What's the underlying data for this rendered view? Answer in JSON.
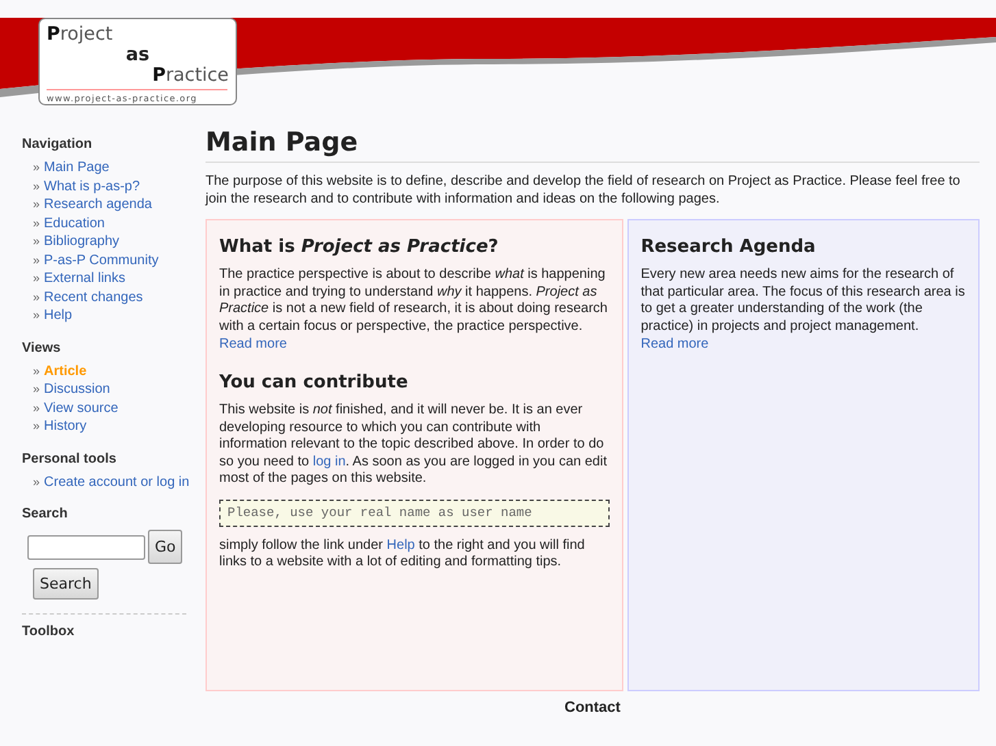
{
  "logo": {
    "words": [
      "**P**roject",
      "as",
      "**P**ractice"
    ],
    "url": "www.project-as-practice.org"
  },
  "sidebar": {
    "navigation": {
      "title": "Navigation",
      "items": [
        {
          "bullet": "»",
          "label": "Main Page"
        },
        {
          "bullet": "»",
          "label": "What is p-as-p?"
        },
        {
          "bullet": "»",
          "label": "Research agenda"
        },
        {
          "bullet": "»",
          "label": "Education"
        },
        {
          "bullet": "»",
          "label": "Bibliography"
        },
        {
          "bullet": "»",
          "label": "P-as-P Community"
        },
        {
          "bullet": "»",
          "label": "External links"
        },
        {
          "bullet": "»",
          "label": "Recent changes"
        },
        {
          "bullet": "»",
          "label": "Help"
        }
      ]
    },
    "views": {
      "title": "Views",
      "items": [
        {
          "bullet": "»",
          "label": "Article",
          "selected": true
        },
        {
          "bullet": "»",
          "label": "Discussion",
          "selected": false
        },
        {
          "bullet": "»",
          "label": "View source",
          "selected": false
        },
        {
          "bullet": "»",
          "label": "History",
          "selected": false
        }
      ]
    },
    "personal_tools": {
      "title": "Personal tools",
      "items": [
        {
          "bullet": "»",
          "label": "Create account or log in"
        }
      ]
    },
    "search": {
      "title": "Search",
      "go": "Go",
      "submit": "Search"
    },
    "toolbox": {
      "title": "Toolbox"
    }
  },
  "page": {
    "title": "Main Page",
    "intro": "The purpose of this website is to define, describe and develop the field of research on Project as Practice. Please feel free to join the research and to contribute with information and ideas on the following pages.",
    "left_box": [
      {
        "kind": "heading",
        "text": "What is *Project as Practice*?"
      },
      {
        "kind": "paragraph",
        "parts": [
          {
            "kind": "text",
            "text": "The practice perspective is about to describe *what* is happening in practice and trying to understand *why* it happens. *Project as Practice* is not a new field of research, it is about doing research with a certain focus or perspective, the practice perspective."
          }
        ]
      },
      {
        "kind": "link",
        "text": "Read more"
      },
      {
        "kind": "heading",
        "text": "You can contribute"
      },
      {
        "kind": "paragraph",
        "parts": [
          {
            "kind": "text",
            "text": "This website is *not* finished, and it will never be. It is an ever developing resource to which you can contribute with information relevant to the topic described above. In order to do so you need to"
          },
          {
            "kind": "link",
            "text": "log in"
          },
          {
            "kind": "text",
            "text": ". As soon as you are logged in you can edit most of the pages on this website."
          }
        ]
      },
      {
        "kind": "note",
        "text": "Please, use your real name as user name"
      },
      {
        "kind": "paragraph",
        "parts": [
          {
            "kind": "text",
            "text": "simply follow the link under"
          },
          {
            "kind": "link",
            "text": "Help"
          },
          {
            "kind": "text",
            "text": "to the right and you will find links to a website with a lot of editing and formatting tips."
          }
        ]
      }
    ],
    "right_box": [
      {
        "kind": "heading",
        "text": "Research Agenda"
      },
      {
        "kind": "paragraph",
        "parts": [
          {
            "kind": "text",
            "text": "Every new area needs new aims for the research of that particular area. The focus of this research area is to get a greater understanding of the work (the practice) in projects and project management."
          }
        ]
      },
      {
        "kind": "link",
        "text": "Read more"
      }
    ],
    "contact_title": "Contact"
  }
}
